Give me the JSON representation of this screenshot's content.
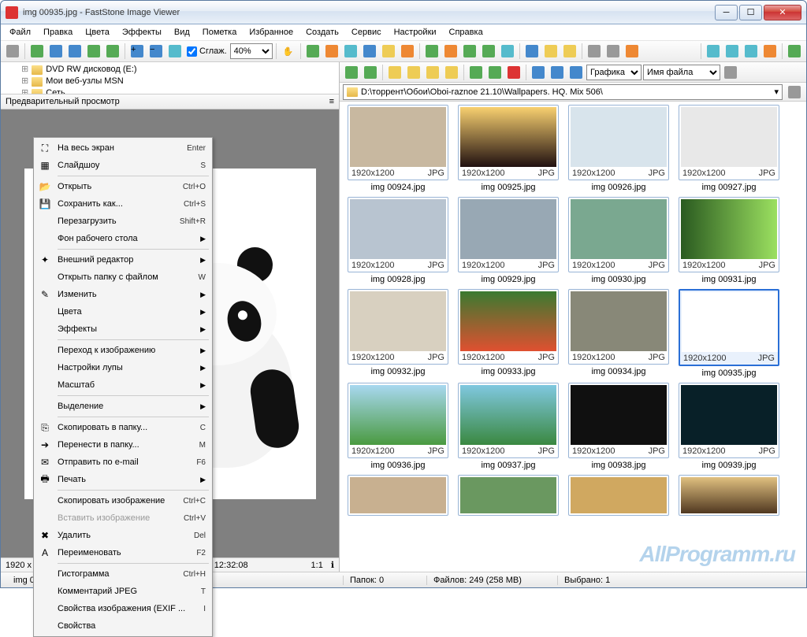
{
  "window": {
    "title": "img 00935.jpg  -  FastStone Image Viewer"
  },
  "menubar": [
    "Файл",
    "Правка",
    "Цвета",
    "Эффекты",
    "Вид",
    "Пометка",
    "Избранное",
    "Создать",
    "Сервис",
    "Настройки",
    "Справка"
  ],
  "toolbar": {
    "smooth_label": "Сглаж.",
    "zoom_value": "40%"
  },
  "tree": {
    "items": [
      {
        "label": "DVD RW дисковод (E:)",
        "icon": "dvd"
      },
      {
        "label": "Мои веб-узлы MSN",
        "icon": "web"
      },
      {
        "label": "Сеть",
        "icon": "network"
      }
    ]
  },
  "preview": {
    "header": "Предварительный просмотр",
    "info_left": "1920 x 1200 (2.30 MP)  24bit  JPG  190 KB  2013-10-28 12:32:08",
    "ratio": "1:1"
  },
  "right_toolbar": {
    "filter_label": "Графика",
    "sort_label": "Имя файла"
  },
  "addressbar": "D:\\торрент\\Обои\\Oboi-raznoe 21.10\\Wallpapers. HQ. Mix 506\\",
  "thumbnails": [
    {
      "name": "img 00924.jpg",
      "dim": "1920x1200",
      "fmt": "JPG",
      "bg": "#c8b8a0"
    },
    {
      "name": "img 00925.jpg",
      "dim": "1920x1200",
      "fmt": "JPG",
      "bg": "linear-gradient(#f8d070,#201010)"
    },
    {
      "name": "img 00926.jpg",
      "dim": "1920x1200",
      "fmt": "JPG",
      "bg": "#d8e4ec"
    },
    {
      "name": "img 00927.jpg",
      "dim": "1920x1200",
      "fmt": "JPG",
      "bg": "#e8e8e8"
    },
    {
      "name": "img 00928.jpg",
      "dim": "1920x1200",
      "fmt": "JPG",
      "bg": "#b8c4d0"
    },
    {
      "name": "img 00929.jpg",
      "dim": "1920x1200",
      "fmt": "JPG",
      "bg": "#98a8b4"
    },
    {
      "name": "img 00930.jpg",
      "dim": "1920x1200",
      "fmt": "JPG",
      "bg": "#7aa890"
    },
    {
      "name": "img 00931.jpg",
      "dim": "1920x1200",
      "fmt": "JPG",
      "bg": "linear-gradient(90deg,#2a5a20,#9be060)"
    },
    {
      "name": "img 00932.jpg",
      "dim": "1920x1200",
      "fmt": "JPG",
      "bg": "#d8d0c0"
    },
    {
      "name": "img 00933.jpg",
      "dim": "1920x1200",
      "fmt": "JPG",
      "bg": "linear-gradient(#3a7a30,#e05030)"
    },
    {
      "name": "img 00934.jpg",
      "dim": "1920x1200",
      "fmt": "JPG",
      "bg": "#888878"
    },
    {
      "name": "img 00935.jpg",
      "dim": "1920x1200",
      "fmt": "JPG",
      "bg": "#ffffff",
      "selected": true
    },
    {
      "name": "img 00936.jpg",
      "dim": "1920x1200",
      "fmt": "JPG",
      "bg": "linear-gradient(#a8d8f0,#4a9a40)"
    },
    {
      "name": "img 00937.jpg",
      "dim": "1920x1200",
      "fmt": "JPG",
      "bg": "linear-gradient(#80c8e0,#3a8840)"
    },
    {
      "name": "img 00938.jpg",
      "dim": "1920x1200",
      "fmt": "JPG",
      "bg": "#101010"
    },
    {
      "name": "img 00939.jpg",
      "dim": "1920x1200",
      "fmt": "JPG",
      "bg": "#082028"
    },
    {
      "name": "",
      "dim": "",
      "fmt": "",
      "bg": "#c8b090",
      "partial": true
    },
    {
      "name": "",
      "dim": "",
      "fmt": "",
      "bg": "#6a9860",
      "partial": true
    },
    {
      "name": "",
      "dim": "",
      "fmt": "",
      "bg": "#d0a860",
      "partial": true
    },
    {
      "name": "",
      "dim": "",
      "fmt": "",
      "bg": "linear-gradient(#e0c080,#503820)",
      "partial": true
    }
  ],
  "statusbar": {
    "file": "img 00935.jpg  [ 168 / 249 ]",
    "folders": "Папок: 0",
    "files": "Файлов: 249 (258 MB)",
    "selected": "Выбрано: 1"
  },
  "context_menu": [
    {
      "icon": "fullscreen",
      "label": "На весь экран",
      "shortcut": "Enter"
    },
    {
      "icon": "slideshow",
      "label": "Слайдшоу",
      "shortcut": "S"
    },
    {
      "sep": true
    },
    {
      "icon": "open",
      "label": "Открыть",
      "shortcut": "Ctrl+O"
    },
    {
      "icon": "save",
      "label": "Сохранить как...",
      "shortcut": "Ctrl+S"
    },
    {
      "label": "Перезагрузить",
      "shortcut": "Shift+R"
    },
    {
      "label": "Фон рабочего стола",
      "sub": true
    },
    {
      "sep": true
    },
    {
      "icon": "ext",
      "label": "Внешний редактор",
      "sub": true
    },
    {
      "label": "Открыть папку с файлом",
      "shortcut": "W"
    },
    {
      "icon": "edit",
      "label": "Изменить",
      "sub": true
    },
    {
      "label": "Цвета",
      "sub": true
    },
    {
      "label": "Эффекты",
      "sub": true
    },
    {
      "sep": true
    },
    {
      "label": "Переход к изображению",
      "sub": true
    },
    {
      "label": "Настройки лупы",
      "sub": true
    },
    {
      "label": "Масштаб",
      "sub": true
    },
    {
      "sep": true
    },
    {
      "label": "Выделение",
      "sub": true
    },
    {
      "sep": true
    },
    {
      "icon": "copyto",
      "label": "Скопировать в папку...",
      "shortcut": "C"
    },
    {
      "icon": "moveto",
      "label": "Перенести в папку...",
      "shortcut": "M"
    },
    {
      "icon": "email",
      "label": "Отправить по e-mail",
      "shortcut": "F6"
    },
    {
      "icon": "print",
      "label": "Печать",
      "sub": true
    },
    {
      "sep": true
    },
    {
      "label": "Скопировать изображение",
      "shortcut": "Ctrl+C"
    },
    {
      "label": "Вставить изображение",
      "shortcut": "Ctrl+V",
      "disabled": true
    },
    {
      "icon": "delete",
      "label": "Удалить",
      "shortcut": "Del"
    },
    {
      "icon": "rename",
      "label": "Переименовать",
      "shortcut": "F2"
    },
    {
      "sep": true
    },
    {
      "label": "Гистограмма",
      "shortcut": "Ctrl+H"
    },
    {
      "label": "Комментарий JPEG",
      "shortcut": "T"
    },
    {
      "label": "Свойства изображения (EXIF ...",
      "shortcut": "I"
    },
    {
      "label": "Свойства"
    }
  ],
  "watermark": "AllProgramm.ru"
}
